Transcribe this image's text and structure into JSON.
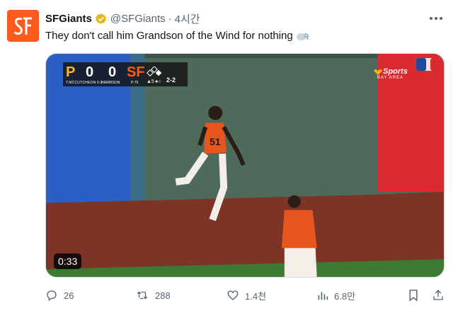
{
  "account": {
    "name": "SFGiants",
    "handle": "@SFGiants",
    "separator": "·",
    "time": "4시간",
    "avatar_icon": "sf-giants-logo",
    "avatar_color": "#fd5a1e",
    "badge_icon": "verified-gold-badge"
  },
  "tweet": {
    "text": "They don't call him Grandson of the Wind for nothing",
    "emoji": "wind-emoji"
  },
  "media": {
    "duration": "0:33",
    "scoreboard": {
      "away_score": "0",
      "home_score": "0",
      "away_logo": "P",
      "home_logo": "SF",
      "inning": "▲5",
      "count": "2-2",
      "batter": "T.MCCUTCHEON 0-2",
      "pitcher": "HARRISON",
      "pitches": "P:79"
    },
    "network": {
      "name": "Sports",
      "region": "BAY AREA"
    },
    "player_number": "51",
    "colors": {
      "wall_blue": "#2c5fc4",
      "wall_green": "#4d6a5a",
      "wall_red": "#d92b2f",
      "track": "#7b3426",
      "grass": "#3d7a32"
    }
  },
  "actions": {
    "replies": "26",
    "reposts": "288",
    "likes": "1.4천",
    "views": "6.8만"
  }
}
